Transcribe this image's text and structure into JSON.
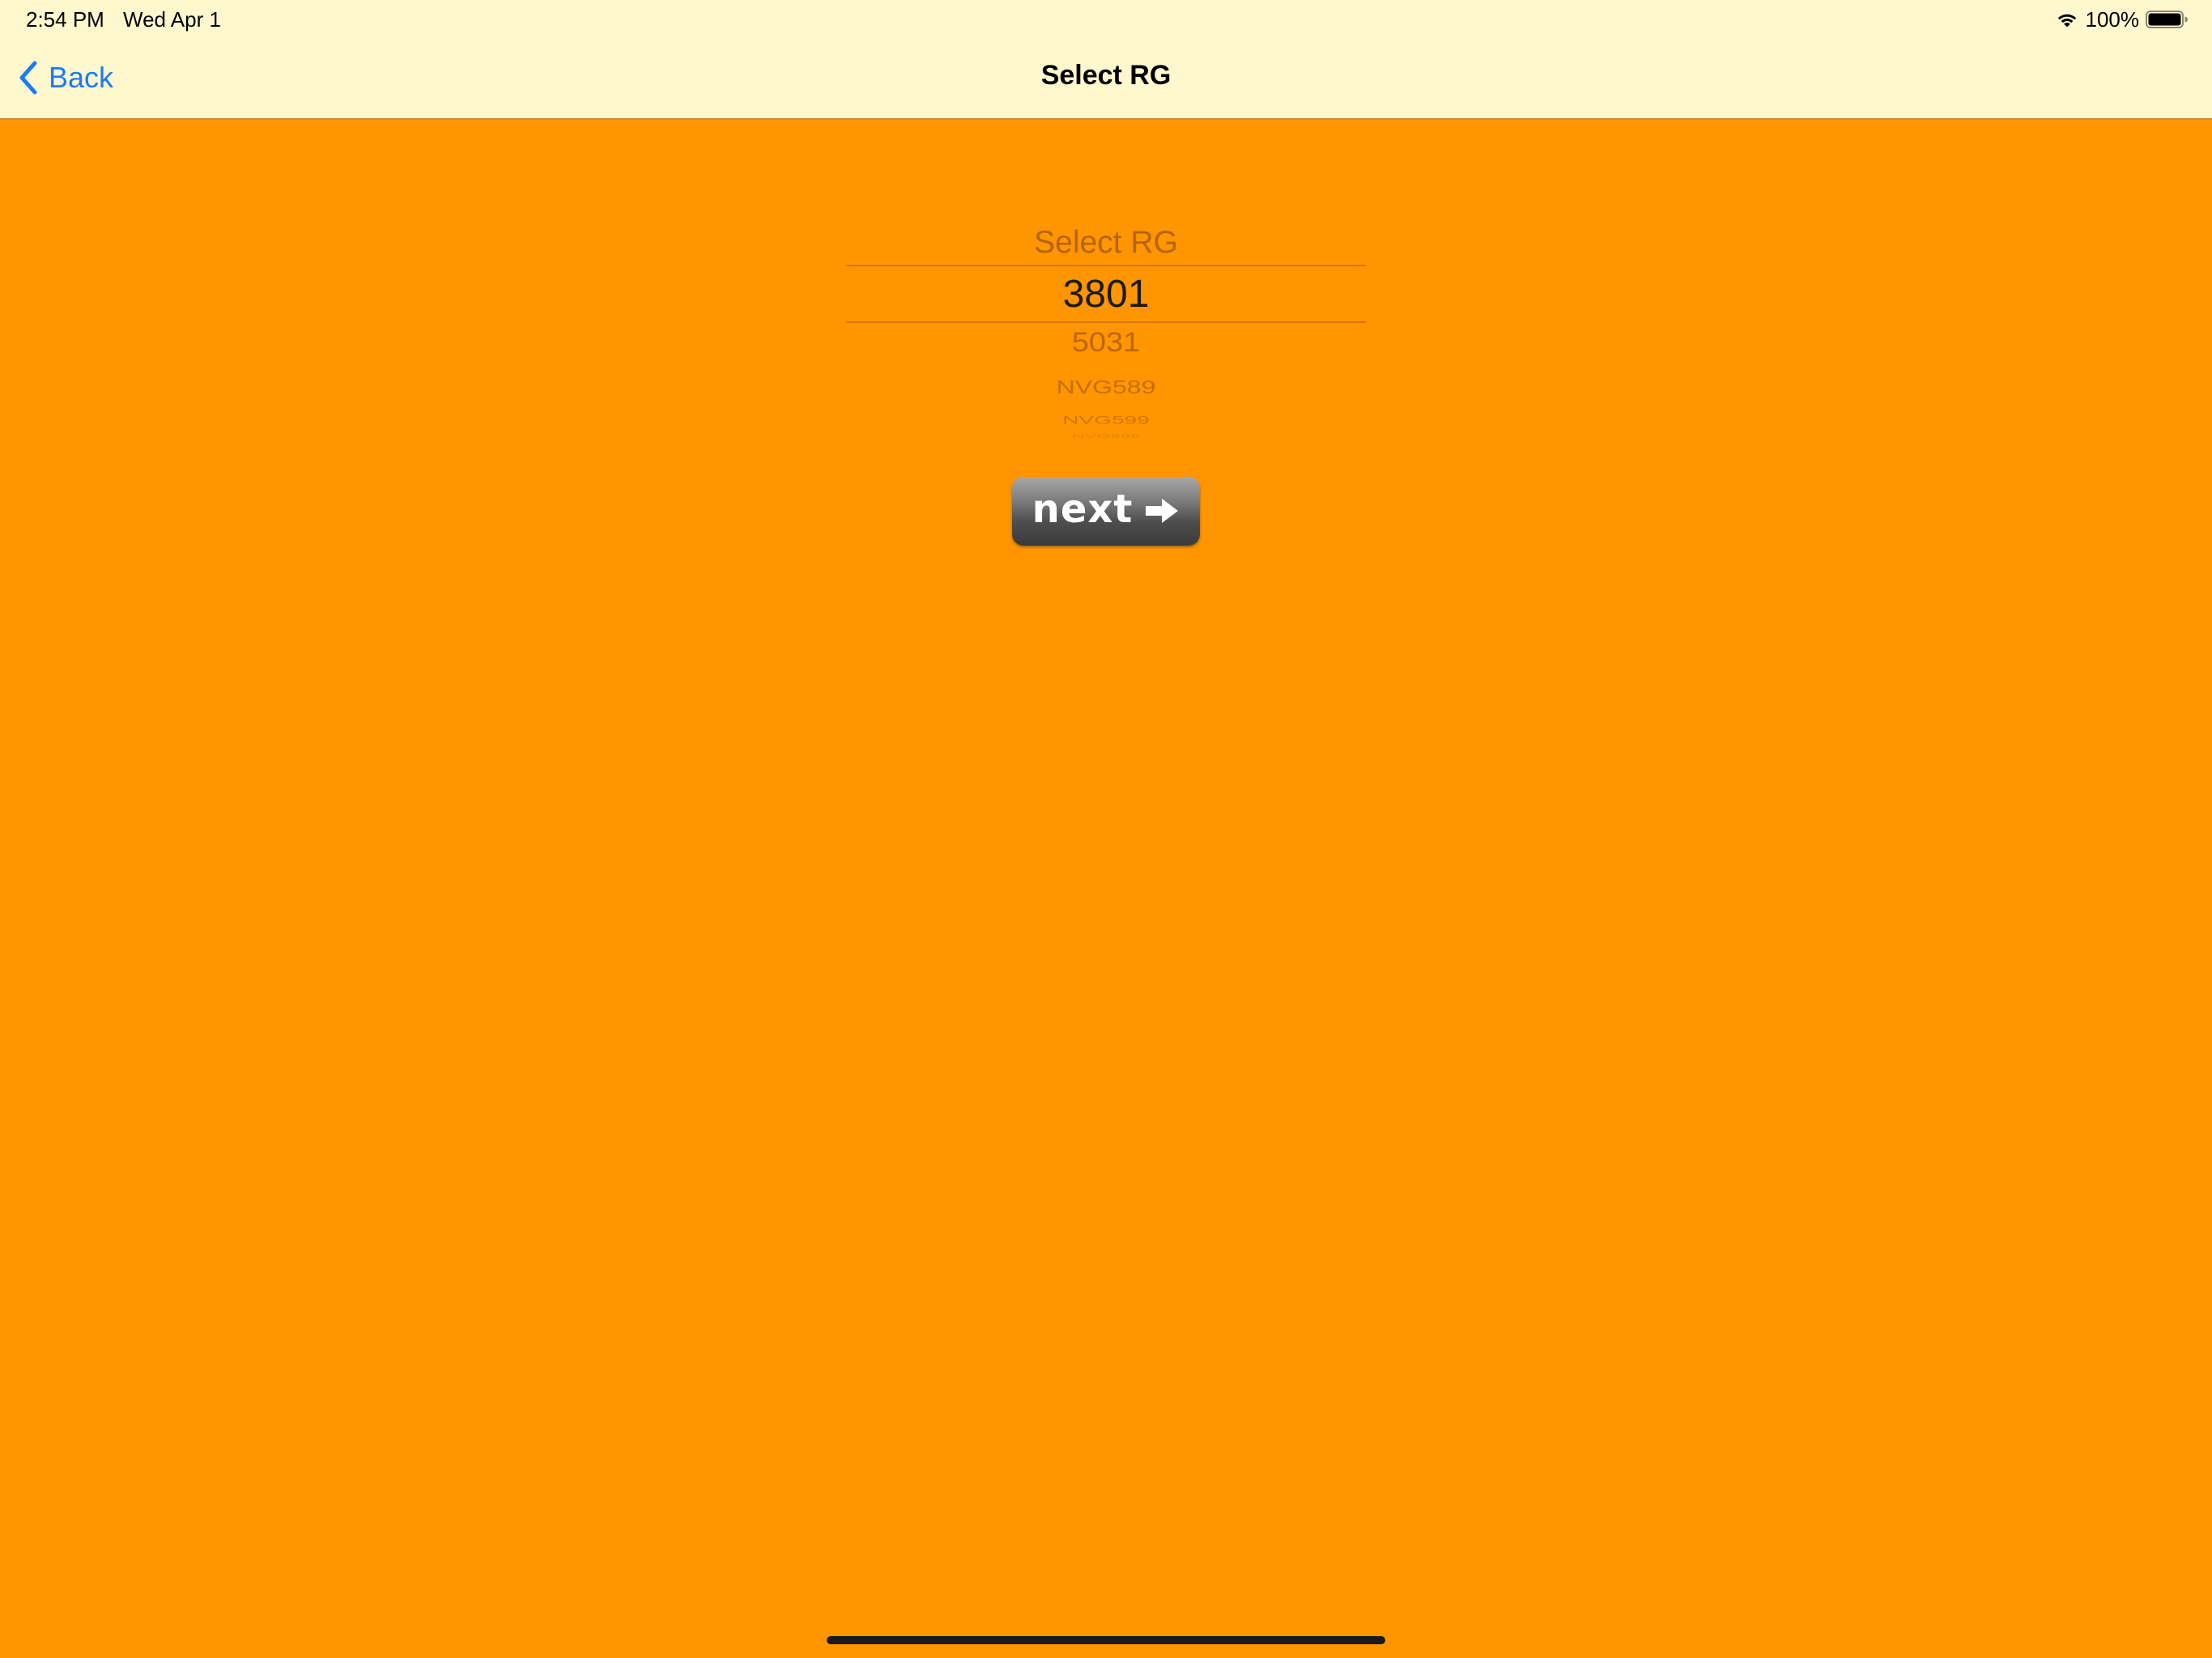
{
  "status_bar": {
    "time": "2:54 PM",
    "date": "Wed Apr 1",
    "battery_percent": "100%",
    "battery_level": 1.0
  },
  "nav_bar": {
    "back_label": "Back",
    "title": "Select RG"
  },
  "picker": {
    "rows": [
      "Select RG",
      "3801",
      "5031",
      "NVG589",
      "NVG599",
      "NVG599"
    ],
    "selected": "3801"
  },
  "next_button": {
    "label": "next"
  },
  "colors": {
    "background": "#FF9500",
    "header_background": "#FFF8CF",
    "link_blue": "#1A7CF5"
  },
  "icons": {
    "wifi": "wifi-icon",
    "battery": "battery-icon",
    "back": "chevron-left-icon",
    "next": "arrow-right-icon"
  }
}
